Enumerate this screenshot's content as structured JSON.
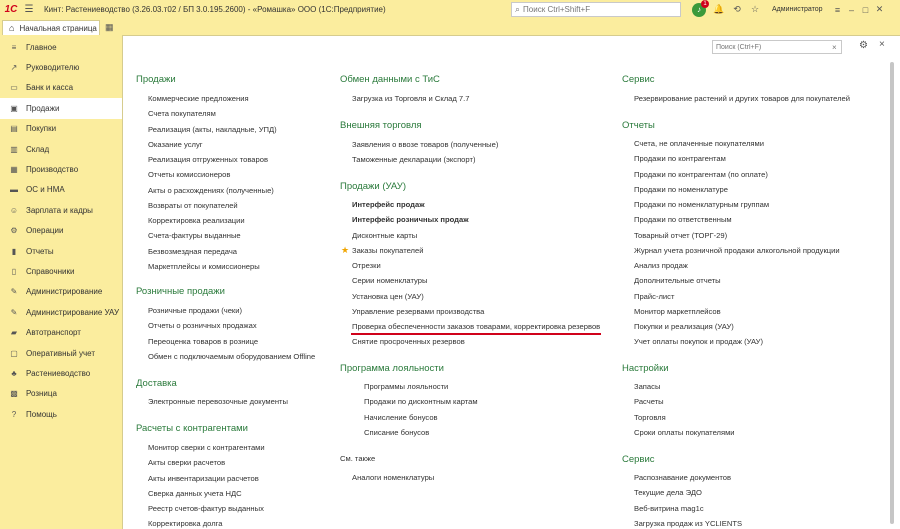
{
  "titlebar": {
    "logo": "1С",
    "title": "Кинт: Растениеводство (3.26.03.т02 / БП 3.0.195.2600) - «Ромашка» ООО  (1С:Предприятие)",
    "search_placeholder": "Поиск Ctrl+Shift+F",
    "notification_count": "1",
    "user": "Администратор"
  },
  "tabs": {
    "home": "Начальная страница"
  },
  "sidebar": {
    "items": [
      {
        "label": "Главное",
        "icon": "menu-icon"
      },
      {
        "label": "Руководителю",
        "icon": "trend-icon"
      },
      {
        "label": "Банк и касса",
        "icon": "bank-icon"
      },
      {
        "label": "Продажи",
        "icon": "bag-icon"
      },
      {
        "label": "Покупки",
        "icon": "cart-icon"
      },
      {
        "label": "Склад",
        "icon": "warehouse-icon"
      },
      {
        "label": "Производство",
        "icon": "factory-icon"
      },
      {
        "label": "ОС и НМА",
        "icon": "truck-icon"
      },
      {
        "label": "Зарплата и кадры",
        "icon": "people-icon"
      },
      {
        "label": "Операции",
        "icon": "gear-icon"
      },
      {
        "label": "Отчеты",
        "icon": "chart-icon"
      },
      {
        "label": "Справочники",
        "icon": "book-icon"
      },
      {
        "label": "Администрирование",
        "icon": "wrench-icon"
      },
      {
        "label": "Администрирование УАУ",
        "icon": "wrench-icon"
      },
      {
        "label": "Автотранспорт",
        "icon": "car-icon"
      },
      {
        "label": "Оперативный учет",
        "icon": "clipboard-icon"
      },
      {
        "label": "Растениеводство",
        "icon": "plant-icon"
      },
      {
        "label": "Розница",
        "icon": "shop-icon"
      },
      {
        "label": "Помощь",
        "icon": "help-icon"
      }
    ],
    "active": "Продажи"
  },
  "content": {
    "search_placeholder": "Поиск (Ctrl+F)",
    "col1": {
      "sec_sales": "Продажи",
      "sales_links": [
        "Коммерческие предложения",
        "Счета покупателям",
        "Реализация (акты, накладные, УПД)",
        "Оказание услуг",
        "Реализация отгруженных товаров",
        "Отчеты комиссионеров",
        "Акты о расхождениях (полученные)",
        "Возвраты от покупателей",
        "Корректировка реализации",
        "Счета-фактуры выданные",
        "Безвозмездная передача",
        "Маркетплейсы и комиссионеры"
      ],
      "sec_retail": "Розничные продажи",
      "retail_links": [
        "Розничные продажи (чеки)",
        "Отчеты о розничных продажах",
        "Переоценка товаров в рознице",
        "Обмен с подключаемым оборудованием Offline"
      ],
      "sec_delivery": "Доставка",
      "delivery_links": [
        "Электронные перевозочные документы"
      ],
      "sec_settlements": "Расчеты с контрагентами",
      "settlements_links": [
        "Монитор сверки с контрагентами",
        "Акты сверки расчетов",
        "Акты инвентаризации расчетов",
        "Сверка данных учета НДС",
        "Реестр счетов-фактур выданных",
        "Корректировка долга"
      ]
    },
    "col2": {
      "sec_exchange": "Обмен данными с ТиС",
      "exchange_links": [
        "Загрузка из Торговля и Склад 7.7"
      ],
      "sec_foreign": "Внешняя торговля",
      "foreign_links": [
        "Заявления о ввозе товаров (полученные)",
        "Таможенные декларации (экспорт)"
      ],
      "sec_sales_uau": "Продажи (УАУ)",
      "sales_uau_links": [
        "Интерфейс продаж",
        "Интерфейс розничных продаж",
        "Дисконтные карты",
        "Заказы покупателей",
        "Отрезки",
        "Серии номенклатуры",
        "Установка цен (УАУ)",
        "Управление резервами производства",
        "Проверка обеспеченности заказов товарами, корректировка резервов",
        "Снятие просроченных резервов"
      ],
      "sec_loyalty": "Программа лояльности",
      "loyalty_links": [
        "Программы лояльности",
        "Продажи по дисконтным картам",
        "Начисление бонусов",
        "Списание бонусов"
      ],
      "see_also": "См. также",
      "see_also_links": [
        "Аналоги номенклатуры"
      ]
    },
    "col3": {
      "sec_service": "Сервис",
      "service_links": [
        "Резервирование растений и других товаров для покупателей"
      ],
      "sec_reports": "Отчеты",
      "reports_links": [
        "Счета, не оплаченные покупателями",
        "Продажи по контрагентам",
        "Продажи по контрагентам (по оплате)",
        "Продажи по номенклатуре",
        "Продажи по номенклатурным группам",
        "Продажи по ответственным",
        "Товарный отчет (ТОРГ-29)",
        "Журнал учета розничной продажи алкогольной продукции",
        "Анализ продаж",
        "Дополнительные отчеты",
        "Прайс-лист",
        "Монитор маркетплейсов",
        "Покупки и реализация (УАУ)",
        "Учет оплаты покупок и продаж (УАУ)"
      ],
      "sec_settings": "Настройки",
      "settings_links": [
        "Запасы",
        "Расчеты",
        "Торговля",
        "Сроки оплаты покупателями"
      ],
      "sec_service2": "Сервис",
      "service2_links": [
        "Распознавание документов",
        "Текущие дела ЭДО",
        "Веб-витрина mag1c",
        "Загрузка продаж из YCLIENTS"
      ]
    }
  }
}
